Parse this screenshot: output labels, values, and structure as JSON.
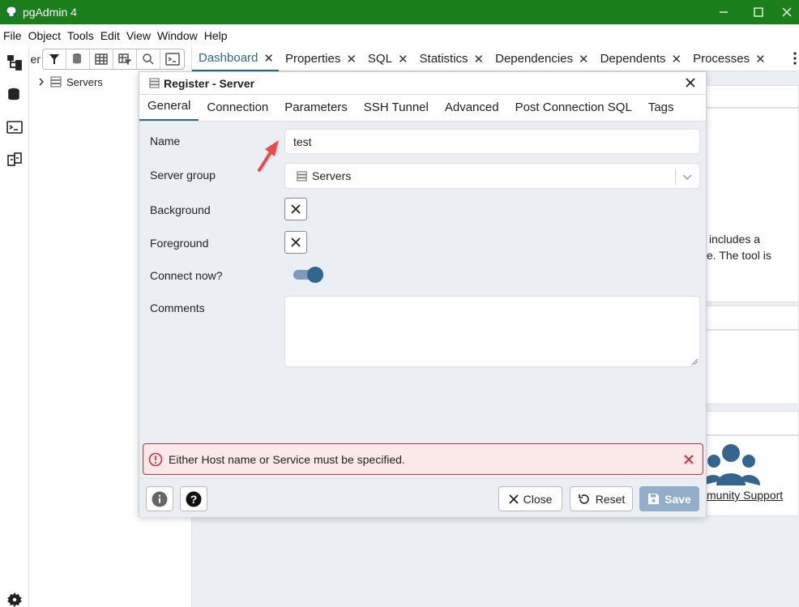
{
  "window": {
    "title": "pgAdmin 4",
    "titlebar_color": "#1a7f1a"
  },
  "menubar": {
    "items": [
      "File",
      "Object",
      "Tools",
      "Edit",
      "View",
      "Window",
      "Help"
    ]
  },
  "explorer": {
    "cut_label": "er",
    "tree": [
      {
        "label": "Servers"
      }
    ]
  },
  "tabs": [
    {
      "label": "Dashboard",
      "active": true
    },
    {
      "label": "Properties"
    },
    {
      "label": "SQL"
    },
    {
      "label": "Statistics"
    },
    {
      "label": "Dependencies"
    },
    {
      "label": "Dependents"
    },
    {
      "label": "Processes"
    }
  ],
  "dashboard": {
    "text_line1": "includes a",
    "text_line2": "e. The tool is",
    "community_link": "munity Support"
  },
  "dialog": {
    "title": "Register - Server",
    "tabs": [
      "General",
      "Connection",
      "Parameters",
      "SSH Tunnel",
      "Advanced",
      "Post Connection SQL",
      "Tags"
    ],
    "active_tab": "General",
    "fields": {
      "name_label": "Name",
      "name_value": "test",
      "server_group_label": "Server group",
      "server_group_value": "Servers",
      "background_label": "Background",
      "foreground_label": "Foreground",
      "connect_now_label": "Connect now?",
      "connect_now": true,
      "comments_label": "Comments",
      "comments_value": ""
    },
    "error": "Either Host name or Service must be specified.",
    "buttons": {
      "close": "Close",
      "reset": "Reset",
      "save": "Save"
    }
  },
  "colors": {
    "accent": "#326690",
    "error_border": "#d32f3c",
    "error_bg": "#fbe9ea",
    "save_disabled": "#93aec9",
    "annotation_arrow": "#f04848"
  }
}
